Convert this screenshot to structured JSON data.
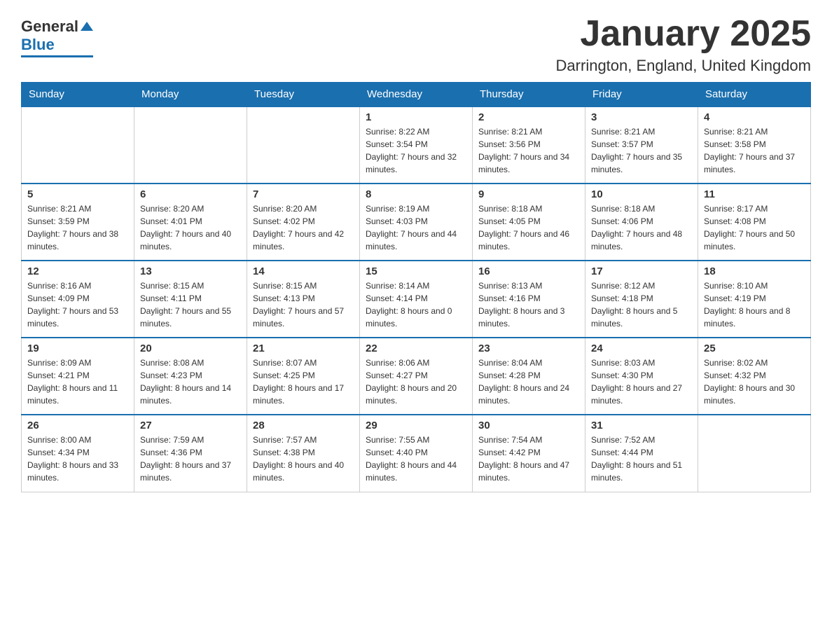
{
  "header": {
    "title": "January 2025",
    "subtitle": "Darrington, England, United Kingdom",
    "logo_general": "General",
    "logo_blue": "Blue"
  },
  "weekdays": [
    "Sunday",
    "Monday",
    "Tuesday",
    "Wednesday",
    "Thursday",
    "Friday",
    "Saturday"
  ],
  "weeks": [
    [
      {
        "day": "",
        "sunrise": "",
        "sunset": "",
        "daylight": ""
      },
      {
        "day": "",
        "sunrise": "",
        "sunset": "",
        "daylight": ""
      },
      {
        "day": "",
        "sunrise": "",
        "sunset": "",
        "daylight": ""
      },
      {
        "day": "1",
        "sunrise": "Sunrise: 8:22 AM",
        "sunset": "Sunset: 3:54 PM",
        "daylight": "Daylight: 7 hours and 32 minutes."
      },
      {
        "day": "2",
        "sunrise": "Sunrise: 8:21 AM",
        "sunset": "Sunset: 3:56 PM",
        "daylight": "Daylight: 7 hours and 34 minutes."
      },
      {
        "day": "3",
        "sunrise": "Sunrise: 8:21 AM",
        "sunset": "Sunset: 3:57 PM",
        "daylight": "Daylight: 7 hours and 35 minutes."
      },
      {
        "day": "4",
        "sunrise": "Sunrise: 8:21 AM",
        "sunset": "Sunset: 3:58 PM",
        "daylight": "Daylight: 7 hours and 37 minutes."
      }
    ],
    [
      {
        "day": "5",
        "sunrise": "Sunrise: 8:21 AM",
        "sunset": "Sunset: 3:59 PM",
        "daylight": "Daylight: 7 hours and 38 minutes."
      },
      {
        "day": "6",
        "sunrise": "Sunrise: 8:20 AM",
        "sunset": "Sunset: 4:01 PM",
        "daylight": "Daylight: 7 hours and 40 minutes."
      },
      {
        "day": "7",
        "sunrise": "Sunrise: 8:20 AM",
        "sunset": "Sunset: 4:02 PM",
        "daylight": "Daylight: 7 hours and 42 minutes."
      },
      {
        "day": "8",
        "sunrise": "Sunrise: 8:19 AM",
        "sunset": "Sunset: 4:03 PM",
        "daylight": "Daylight: 7 hours and 44 minutes."
      },
      {
        "day": "9",
        "sunrise": "Sunrise: 8:18 AM",
        "sunset": "Sunset: 4:05 PM",
        "daylight": "Daylight: 7 hours and 46 minutes."
      },
      {
        "day": "10",
        "sunrise": "Sunrise: 8:18 AM",
        "sunset": "Sunset: 4:06 PM",
        "daylight": "Daylight: 7 hours and 48 minutes."
      },
      {
        "day": "11",
        "sunrise": "Sunrise: 8:17 AM",
        "sunset": "Sunset: 4:08 PM",
        "daylight": "Daylight: 7 hours and 50 minutes."
      }
    ],
    [
      {
        "day": "12",
        "sunrise": "Sunrise: 8:16 AM",
        "sunset": "Sunset: 4:09 PM",
        "daylight": "Daylight: 7 hours and 53 minutes."
      },
      {
        "day": "13",
        "sunrise": "Sunrise: 8:15 AM",
        "sunset": "Sunset: 4:11 PM",
        "daylight": "Daylight: 7 hours and 55 minutes."
      },
      {
        "day": "14",
        "sunrise": "Sunrise: 8:15 AM",
        "sunset": "Sunset: 4:13 PM",
        "daylight": "Daylight: 7 hours and 57 minutes."
      },
      {
        "day": "15",
        "sunrise": "Sunrise: 8:14 AM",
        "sunset": "Sunset: 4:14 PM",
        "daylight": "Daylight: 8 hours and 0 minutes."
      },
      {
        "day": "16",
        "sunrise": "Sunrise: 8:13 AM",
        "sunset": "Sunset: 4:16 PM",
        "daylight": "Daylight: 8 hours and 3 minutes."
      },
      {
        "day": "17",
        "sunrise": "Sunrise: 8:12 AM",
        "sunset": "Sunset: 4:18 PM",
        "daylight": "Daylight: 8 hours and 5 minutes."
      },
      {
        "day": "18",
        "sunrise": "Sunrise: 8:10 AM",
        "sunset": "Sunset: 4:19 PM",
        "daylight": "Daylight: 8 hours and 8 minutes."
      }
    ],
    [
      {
        "day": "19",
        "sunrise": "Sunrise: 8:09 AM",
        "sunset": "Sunset: 4:21 PM",
        "daylight": "Daylight: 8 hours and 11 minutes."
      },
      {
        "day": "20",
        "sunrise": "Sunrise: 8:08 AM",
        "sunset": "Sunset: 4:23 PM",
        "daylight": "Daylight: 8 hours and 14 minutes."
      },
      {
        "day": "21",
        "sunrise": "Sunrise: 8:07 AM",
        "sunset": "Sunset: 4:25 PM",
        "daylight": "Daylight: 8 hours and 17 minutes."
      },
      {
        "day": "22",
        "sunrise": "Sunrise: 8:06 AM",
        "sunset": "Sunset: 4:27 PM",
        "daylight": "Daylight: 8 hours and 20 minutes."
      },
      {
        "day": "23",
        "sunrise": "Sunrise: 8:04 AM",
        "sunset": "Sunset: 4:28 PM",
        "daylight": "Daylight: 8 hours and 24 minutes."
      },
      {
        "day": "24",
        "sunrise": "Sunrise: 8:03 AM",
        "sunset": "Sunset: 4:30 PM",
        "daylight": "Daylight: 8 hours and 27 minutes."
      },
      {
        "day": "25",
        "sunrise": "Sunrise: 8:02 AM",
        "sunset": "Sunset: 4:32 PM",
        "daylight": "Daylight: 8 hours and 30 minutes."
      }
    ],
    [
      {
        "day": "26",
        "sunrise": "Sunrise: 8:00 AM",
        "sunset": "Sunset: 4:34 PM",
        "daylight": "Daylight: 8 hours and 33 minutes."
      },
      {
        "day": "27",
        "sunrise": "Sunrise: 7:59 AM",
        "sunset": "Sunset: 4:36 PM",
        "daylight": "Daylight: 8 hours and 37 minutes."
      },
      {
        "day": "28",
        "sunrise": "Sunrise: 7:57 AM",
        "sunset": "Sunset: 4:38 PM",
        "daylight": "Daylight: 8 hours and 40 minutes."
      },
      {
        "day": "29",
        "sunrise": "Sunrise: 7:55 AM",
        "sunset": "Sunset: 4:40 PM",
        "daylight": "Daylight: 8 hours and 44 minutes."
      },
      {
        "day": "30",
        "sunrise": "Sunrise: 7:54 AM",
        "sunset": "Sunset: 4:42 PM",
        "daylight": "Daylight: 8 hours and 47 minutes."
      },
      {
        "day": "31",
        "sunrise": "Sunrise: 7:52 AM",
        "sunset": "Sunset: 4:44 PM",
        "daylight": "Daylight: 8 hours and 51 minutes."
      },
      {
        "day": "",
        "sunrise": "",
        "sunset": "",
        "daylight": ""
      }
    ]
  ]
}
